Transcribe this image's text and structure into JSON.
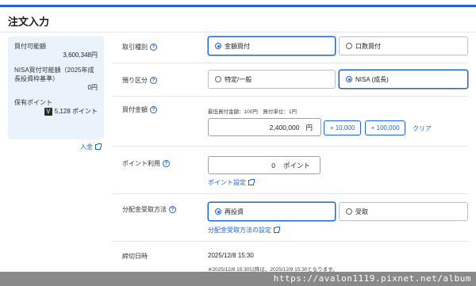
{
  "page": {
    "title": "注文入力"
  },
  "summary": {
    "buying_power_label": "買付可能額",
    "buying_power_value": "3,600,348円",
    "nisa_label": "NISA買付可能額（2025年成長投資枠基準）",
    "nisa_value": "0円",
    "points_label": "保有ポイント",
    "points_value": "5,128 ポイント",
    "points_icon_letter": "V",
    "deposit_link": "入金"
  },
  "form": {
    "trade_type": {
      "label": "取引種別",
      "options": [
        "金額買付",
        "口数買付"
      ],
      "selected": "金額買付"
    },
    "account_type": {
      "label": "預り区分",
      "options": [
        "特定/一般",
        "NISA (成長)"
      ],
      "selected": "NISA (成長)"
    },
    "amount": {
      "label": "買付金額",
      "note": "最低買付金額：100円　買付単位：1円",
      "value": "2,400,000",
      "unit": "円",
      "buttons": [
        "+ 10,000",
        "+ 100,000"
      ],
      "clear_label": "クリア"
    },
    "points": {
      "label": "ポイント利用",
      "value": "0",
      "unit": "ポイント",
      "settings_link": "ポイント設定"
    },
    "distribution": {
      "label": "分配金受取方法",
      "options": [
        "再投資",
        "受取"
      ],
      "selected": "再投資",
      "settings_link": "分配金受取方法の設定"
    },
    "deadline": {
      "label": "締切日時",
      "value": "2025/12/8 15:30",
      "note": "※2025/12/8 15:30以降は、2025/12/9 15:30となります。"
    }
  },
  "watermark": "https://avalon1119.pixnet.net/album",
  "colors": {
    "accent": "#1f63d6",
    "panel_bg": "#eaf3fb"
  }
}
